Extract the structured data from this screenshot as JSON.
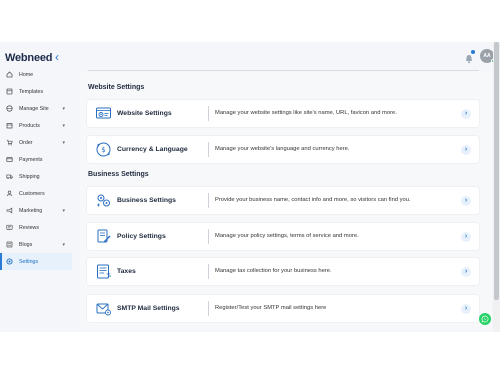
{
  "brand": {
    "name": "Webneed"
  },
  "topbar": {
    "avatar_initials": "AA"
  },
  "sidebar": {
    "items": [
      {
        "label": "Home",
        "icon": "home-icon",
        "caret": false,
        "active": false
      },
      {
        "label": "Templates",
        "icon": "templates-icon",
        "caret": false,
        "active": false
      },
      {
        "label": "Manage Site",
        "icon": "globe-icon",
        "caret": true,
        "active": false
      },
      {
        "label": "Products",
        "icon": "box-icon",
        "caret": true,
        "active": false
      },
      {
        "label": "Order",
        "icon": "cart-icon",
        "caret": true,
        "active": false
      },
      {
        "label": "Payments",
        "icon": "card-icon",
        "caret": false,
        "active": false
      },
      {
        "label": "Shipping",
        "icon": "truck-icon",
        "caret": false,
        "active": false
      },
      {
        "label": "Customers",
        "icon": "users-icon",
        "caret": false,
        "active": false
      },
      {
        "label": "Marketing",
        "icon": "megaphone-icon",
        "caret": true,
        "active": false
      },
      {
        "label": "Reviews",
        "icon": "star-icon",
        "caret": false,
        "active": false
      },
      {
        "label": "Blogs",
        "icon": "blog-icon",
        "caret": true,
        "active": false
      },
      {
        "label": "Settings",
        "icon": "gear-icon",
        "caret": false,
        "active": true
      }
    ]
  },
  "sections": {
    "website": {
      "title": "Website Settings"
    },
    "business": {
      "title": "Business Settings"
    }
  },
  "cards": {
    "website_settings": {
      "title": "Website Settings",
      "desc": "Manage your website settings like site's name, URL, favicon and more."
    },
    "currency_language": {
      "title": "Currency & Language",
      "desc": "Manage your website's language and currency here."
    },
    "business_settings": {
      "title": "Business Settings",
      "desc": "Provide your business name, contact info and more, so visitors can find you."
    },
    "policy_settings": {
      "title": "Policy Settings",
      "desc": "Manage your policy settings, terms of service and more."
    },
    "taxes": {
      "title": "Taxes",
      "desc": "Manage tax collection for your business here."
    },
    "smtp_mail": {
      "title": "SMTP Mail Settings",
      "desc": "Register/Test your SMTP mail settings here"
    }
  },
  "colors": {
    "accent": "#2a7bd4",
    "active_bg": "#e6f1fb",
    "whatsapp": "#25d366"
  }
}
